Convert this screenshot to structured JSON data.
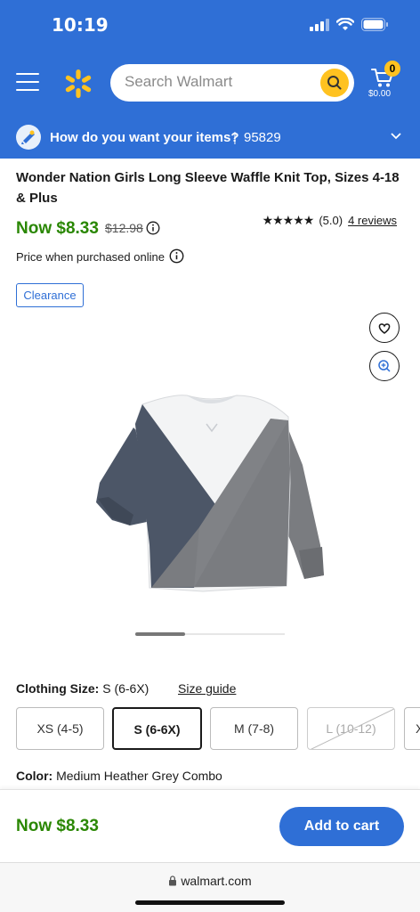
{
  "status_bar": {
    "time": "10:19"
  },
  "header": {
    "search_placeholder": "Search Walmart",
    "cart_count": "0",
    "cart_total": "$0.00"
  },
  "delivery": {
    "prompt": "How do you want your items?",
    "separator": "|",
    "zip": "95829"
  },
  "product": {
    "title": "Wonder Nation Girls Long Sleeve Waffle Knit Top, Sizes 4-18 & Plus",
    "price_now": "Now $8.33",
    "price_was": "$12.98",
    "stars": "★★★★★",
    "rating": "(5.0)",
    "reviews": "4 reviews",
    "price_note": "Price when purchased online",
    "badge": "Clearance",
    "image_carousel": {
      "current_image": 1,
      "total_images": 3
    }
  },
  "size": {
    "label": "Clothing Size:",
    "selected": "S (6-6X)",
    "guide": "Size guide",
    "options": [
      "XS (4-5)",
      "S (6-6X)",
      "M (7-8)",
      "L (10-12)",
      "XL"
    ]
  },
  "color": {
    "label": "Color:",
    "selected": "Medium Heather Grey Combo"
  },
  "bottom_bar": {
    "price": "Now $8.33",
    "add_to_cart": "Add to cart"
  },
  "browser": {
    "url": "walmart.com"
  },
  "colors": {
    "brand_blue": "#2f6fd6",
    "spark_yellow": "#ffc220",
    "price_green": "#2a8703"
  }
}
